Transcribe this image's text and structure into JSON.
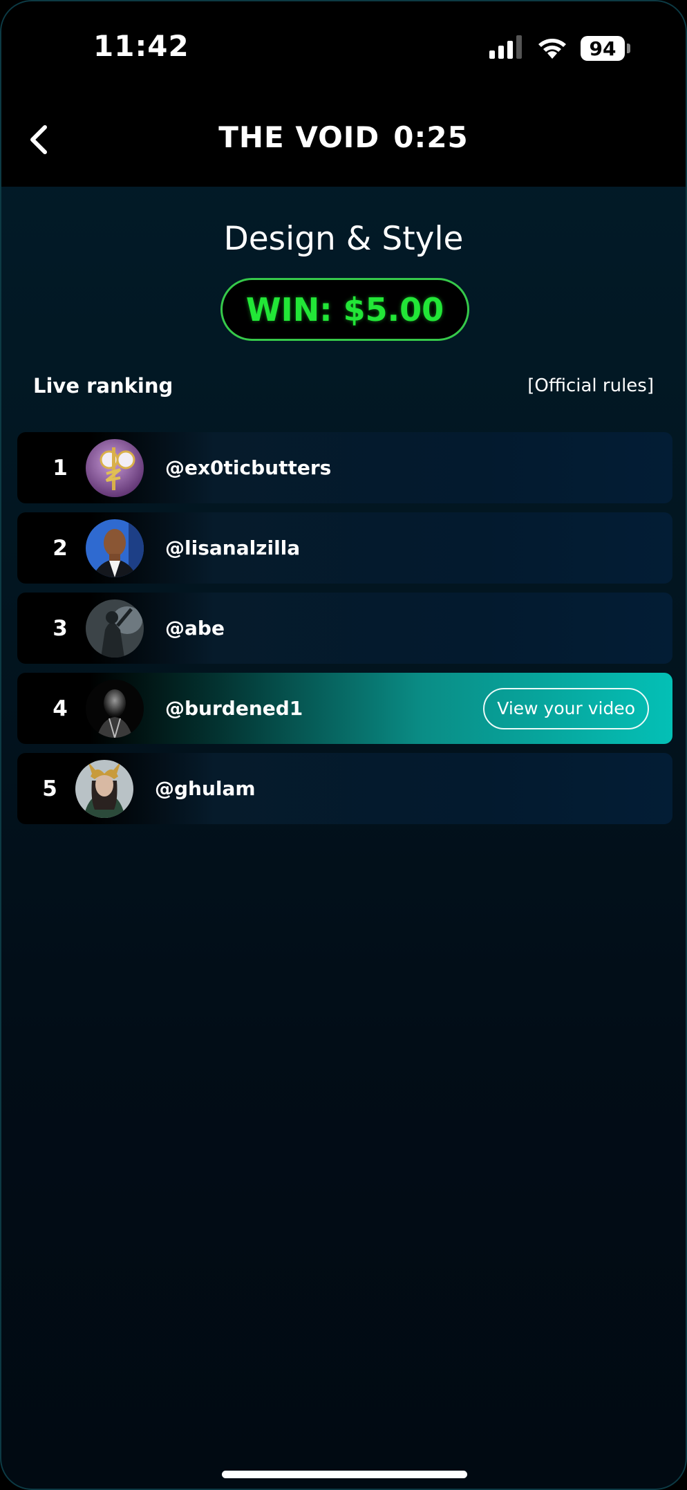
{
  "status_bar": {
    "time": "11:42",
    "battery": "94",
    "icons": [
      "signal-icon",
      "wifi-icon",
      "battery-icon"
    ]
  },
  "header": {
    "title": "THE VOID",
    "timer": "0:25",
    "back_icon": "chevron-left-icon"
  },
  "contest": {
    "title": "Design & Style",
    "prize": "WIN: $5.00"
  },
  "ranking": {
    "label": "Live ranking",
    "rules_link": "[Official rules]",
    "entries": [
      {
        "rank": "1",
        "username": "@ex0ticbutters"
      },
      {
        "rank": "2",
        "username": "@lisanalzilla"
      },
      {
        "rank": "3",
        "username": "@abe"
      },
      {
        "rank": "4",
        "username": "@burdened1",
        "action_label": "View your video"
      },
      {
        "rank": "5",
        "username": "@ghulam"
      }
    ]
  },
  "colors": {
    "prize_green": "#22e637",
    "highlight_teal": "#04c0b6",
    "background": "#021621"
  }
}
